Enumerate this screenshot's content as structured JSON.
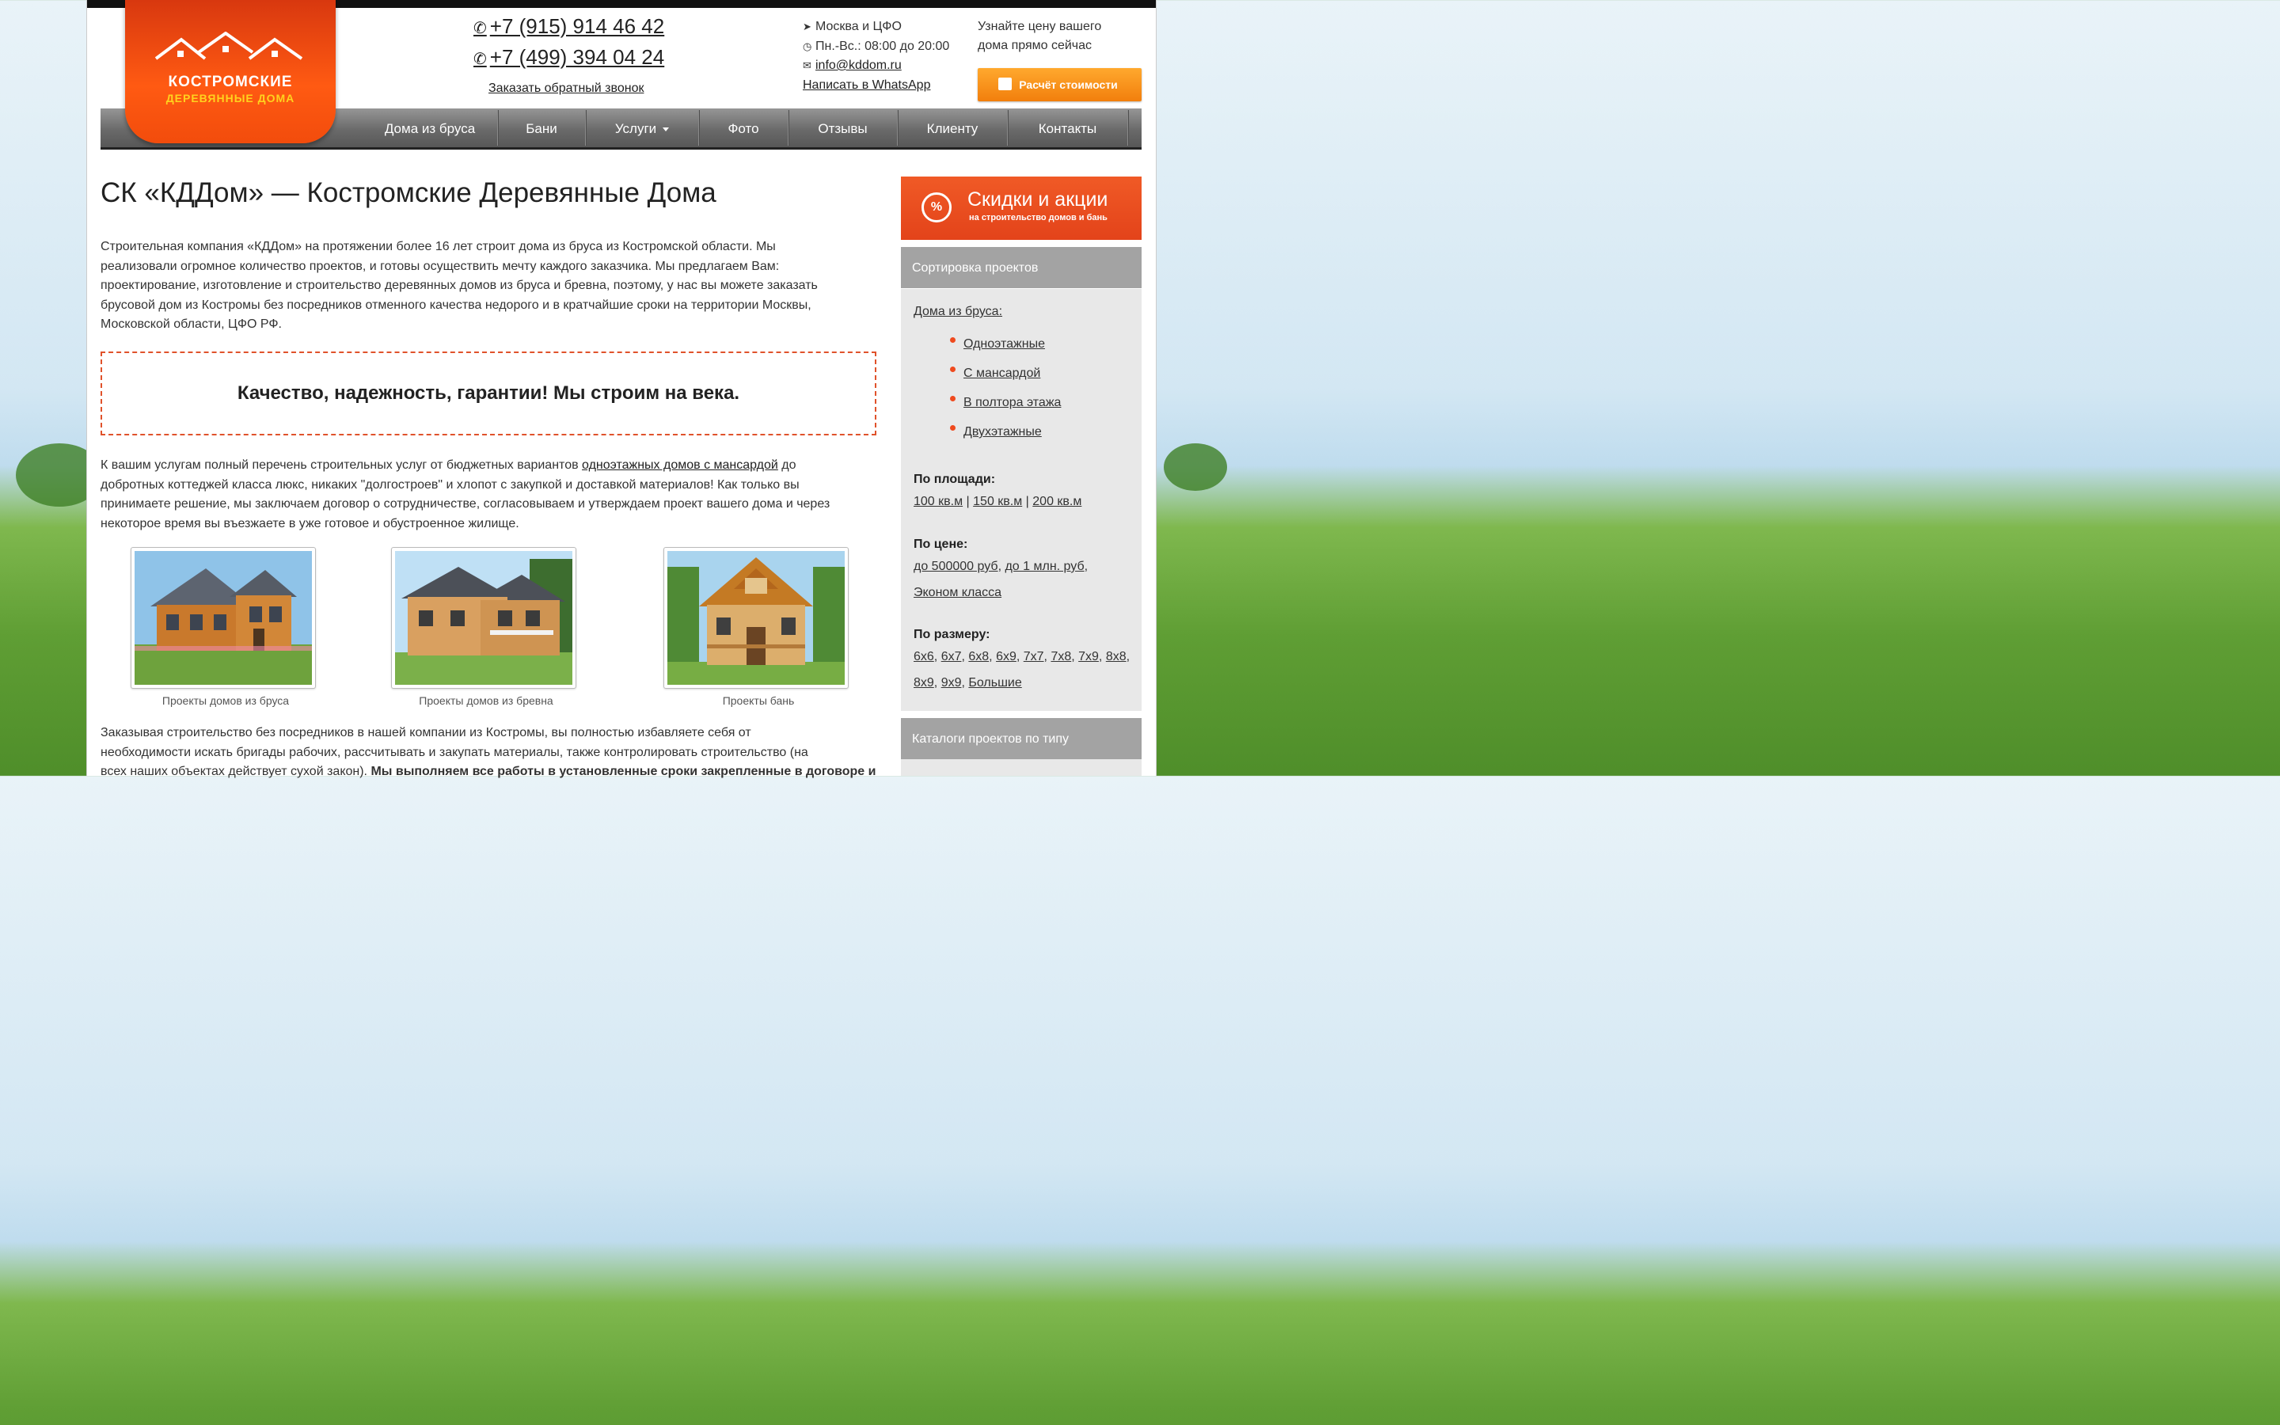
{
  "header": {
    "logo_line1": "КОСТРОМСКИЕ",
    "logo_line2": "ДЕРЕВЯННЫЕ ДОМА",
    "phone1": "+7 (915) 914 46 42",
    "phone2": "+7 (499) 394 04 24",
    "callback": "Заказать обратный звонок",
    "region": "Москва и ЦФО",
    "hours": "Пн.-Вс.: 08:00 до 20:00",
    "email": "info@kddom.ru",
    "whatsapp": "Написать в WhatsApp",
    "price_line1": "Узнайте цену вашего",
    "price_line2": "дома прямо сейчас",
    "calc_button": "Расчёт стоимости"
  },
  "nav": {
    "items": [
      "Дома из бруса",
      "Бани",
      "Услуги",
      "Фото",
      "Отзывы",
      "Клиенту",
      "Контакты"
    ]
  },
  "main": {
    "title": "СК «КДДом» — Костромские Деревянные Дома",
    "intro": [
      "Строительная компания «КДДом» на протяжении более 16 лет строит дома из бруса из Костромской области. Мы",
      "реализовали огромное количество проектов, и готовы осуществить мечту каждого заказчика. Мы предлагаем Вам:",
      "проектирование, изготовление и строительство деревянных домов из бруса и бревна, поэтому, у нас вы можете заказать",
      "брусовой дом из Костромы без посредников отменного качества недорого и в кратчайшие сроки на территории Москвы,",
      "Московской области, ЦФО РФ."
    ],
    "slogan": "Качество, надежность, гарантии! Мы строим на века.",
    "services_l1_a": "К вашим услугам полный перечень строительных услуг от бюджетных вариантов ",
    "services_l1_link": "одноэтажных домов с мансардой",
    "services_l1_b": " до",
    "services_rest": [
      "добротных коттеджей класса люкс, никаких \"долгостроев\" и хлопот с закупкой и доставкой материалов! Как только вы",
      "принимаете решение, мы заключаем договор о сотрудничестве, согласовываем и утверждаем проект вашего дома и через",
      "некоторое время вы въезжаете в уже готовое и обустроенное жилище."
    ],
    "projects": [
      {
        "caption": "Проекты домов из бруса"
      },
      {
        "caption": "Проекты домов из бревна"
      },
      {
        "caption": "Проекты бань"
      }
    ],
    "bottom_l1": "Заказывая строительство без посредников в нашей компании из Костромы, вы полностью избавляете себя от",
    "bottom_l2": "необходимости искать бригады рабочих, рассчитывать и закупать материалы, также контролировать строительство (на",
    "bottom_l3_a": "всех наших объектах действует сухой закон). ",
    "bottom_l3_b": "Мы выполняем все работы в установленные сроки закрепленные в договоре и"
  },
  "sidebar": {
    "banner_title": "Скидки и акции",
    "banner_sub": "на строительство домов и бань",
    "sort_header": "Сортировка проектов",
    "brus_link": "Дома из бруса:",
    "floors": [
      "Одноэтажные",
      "С мансардой",
      "В полтора этажа",
      "Двухэтажные"
    ],
    "area_label": "По площади:",
    "area": [
      "100 кв.м",
      "150 кв.м",
      "200 кв.м"
    ],
    "price_label": "По цене:",
    "price": [
      "до 500000 руб",
      "до 1 млн. руб",
      "Эконом класса"
    ],
    "size_label": "По размеру:",
    "sizes_row1": [
      "6х6",
      "6х7",
      "6х8",
      "6х9",
      "7х7",
      "7х8",
      "7х9",
      "8х8"
    ],
    "sizes_row2": [
      "8х9",
      "9х9",
      "Большие"
    ],
    "catalog_header": "Каталоги проектов по типу"
  }
}
